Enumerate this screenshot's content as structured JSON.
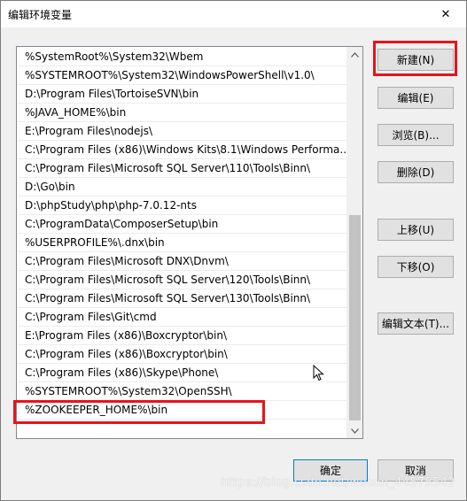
{
  "window": {
    "title": "编辑环境变量",
    "close_glyph": "✕"
  },
  "path_list": {
    "items": [
      "%SystemRoot%\\System32\\Wbem",
      "%SYSTEMROOT%\\System32\\WindowsPowerShell\\v1.0\\",
      "D:\\Program Files\\TortoiseSVN\\bin",
      "%JAVA_HOME%\\bin",
      "E:\\Program Files\\nodejs\\",
      "C:\\Program Files (x86)\\Windows Kits\\8.1\\Windows Performa...",
      "C:\\Program Files\\Microsoft SQL Server\\110\\Tools\\Binn\\",
      "D:\\Go\\bin",
      "D:\\phpStudy\\php\\php-7.0.12-nts",
      "C:\\ProgramData\\ComposerSetup\\bin",
      "%USERPROFILE%\\.dnx\\bin",
      "C:\\Program Files\\Microsoft DNX\\Dnvm\\",
      "C:\\Program Files\\Microsoft SQL Server\\120\\Tools\\Binn\\",
      "C:\\Program Files\\Microsoft SQL Server\\130\\Tools\\Binn\\",
      "C:\\Program Files\\Git\\cmd",
      "E:\\Program Files (x86)\\Boxcryptor\\bin\\",
      "C:\\Program Files (x86)\\Boxcryptor\\bin\\",
      "C:\\Program Files (x86)\\Skype\\Phone\\",
      "%SYSTEMROOT%\\System32\\OpenSSH\\",
      "%ZOOKEEPER_HOME%\\bin"
    ]
  },
  "buttons": {
    "new": "新建(N)",
    "edit": "编辑(E)",
    "browse": "浏览(B)...",
    "delete": "删除(D)",
    "move_up": "上移(U)",
    "move_down": "下移(O)",
    "edit_text": "编辑文本(T)...",
    "ok": "确定",
    "cancel": "取消"
  },
  "watermark": "https://blog.csdn.net/weixin_44575542",
  "colors": {
    "highlight": "#e8131a",
    "button_face": "#e1e1e1",
    "default_border": "#0078d7"
  }
}
